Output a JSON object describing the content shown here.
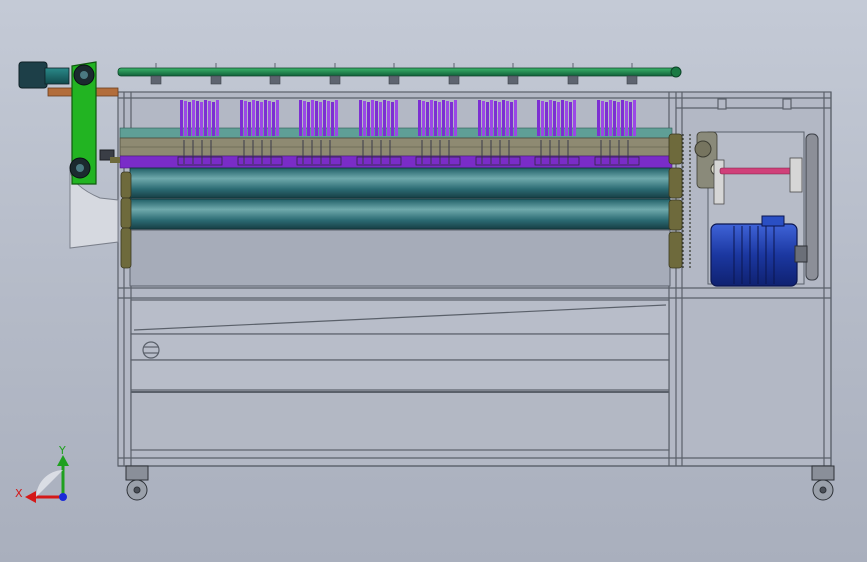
{
  "viewport": {
    "model": "brush-roller-washing-machine",
    "view": "front",
    "colors": {
      "background_top": "#c4cad6",
      "background_bottom": "#a9afbd",
      "frame": "#5a606a",
      "top_rail": "#1f8a4c",
      "brushes": "#8a35d8",
      "rollers": "#2f6f76",
      "belt_guard": "#22b422",
      "motor": "#1c3fa8",
      "shaft": "#d0407a"
    }
  },
  "triad": {
    "x_label": "X",
    "y_label": "Y",
    "x_color": "#d41818",
    "y_color": "#1ea01e",
    "z_color": "#1a2ad8"
  }
}
